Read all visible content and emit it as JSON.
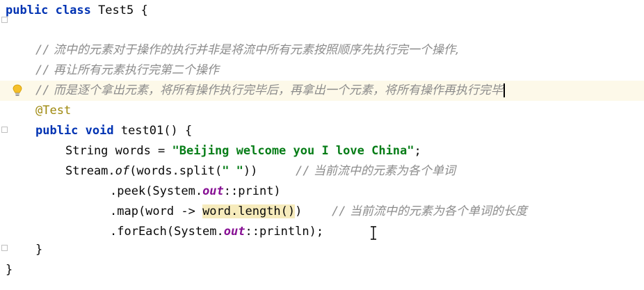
{
  "code": {
    "line1": {
      "kw": "public class",
      "rest": " Test5 {"
    },
    "line3": {
      "slash": "//",
      "text": " 流中的元素对于操作的执行并非是将流中所有元素按照顺序先执行完一个操作,"
    },
    "line4": {
      "slash": "//",
      "text": " 再让所有元素执行完第二个操作"
    },
    "line5": {
      "slash": "//",
      "text": " 而是逐个拿出元素，将所有操作执行完毕后，再拿出一个元素，将所有操作再执行完毕"
    },
    "line6": {
      "anno": "@Test"
    },
    "line7": {
      "kw": "public void",
      "rest": " test01() {"
    },
    "line8": {
      "pre": "String words = ",
      "str": "\"Beijing welcome you I love China\"",
      "post": ";"
    },
    "line9": {
      "pre": "Stream.",
      "fn": "of",
      "mid": "(words.split(",
      "str": "\" \"",
      "post": "))",
      "slash": "//",
      "cmt": " 当前流中的元素为各个单词"
    },
    "line10": {
      "pre": ".peek(System.",
      "field": "out",
      "post": "::print)"
    },
    "line11": {
      "pre": ".map(word -> ",
      "hl": "word.length()",
      "post": ")",
      "slash": "//",
      "cmt": " 当前流中的元素为各个单词的长度"
    },
    "line12": {
      "pre": ".forEach(System.",
      "field": "out",
      "post": "::println);"
    },
    "line13": {
      "text": "}"
    },
    "line14": {
      "text": "}"
    }
  },
  "icons": {
    "bulb": "lightbulb-icon",
    "fold": "fold-marker-icon",
    "cursor": "text-cursor-icon"
  },
  "colors": {
    "keyword": "#0033b3",
    "string": "#067d17",
    "comment": "#8c8c8c",
    "annotation": "#9e880d",
    "static_field": "#871094",
    "current_line": "#fdf9e9",
    "highlight": "#f6ebbc"
  }
}
